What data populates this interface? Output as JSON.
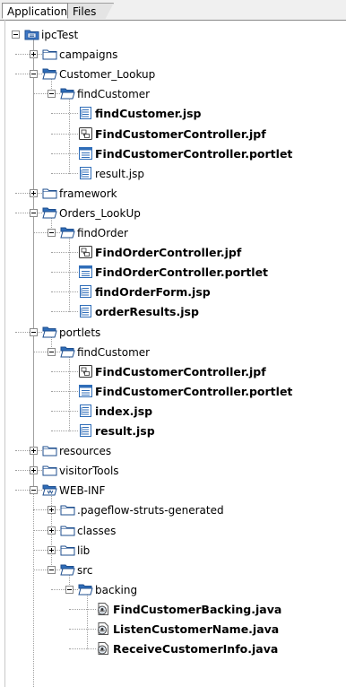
{
  "tabs": [
    {
      "label": "Application",
      "active": true
    },
    {
      "label": "Files",
      "active": false
    }
  ],
  "tree": [
    {
      "label": "ipcTest",
      "icon": "project-icon",
      "depth": 0,
      "expander": "minus",
      "bold": false
    },
    {
      "label": "campaigns",
      "icon": "folder-closed-icon",
      "depth": 1,
      "expander": "plus",
      "bold": false
    },
    {
      "label": "Customer_Lookup",
      "icon": "folder-open-icon",
      "depth": 1,
      "expander": "minus",
      "bold": false
    },
    {
      "label": "findCustomer",
      "icon": "folder-open-icon",
      "depth": 2,
      "expander": "minus",
      "bold": false
    },
    {
      "label": "findCustomer.jsp",
      "icon": "jsp-file-icon",
      "depth": 3,
      "expander": null,
      "bold": true
    },
    {
      "label": "FindCustomerController.jpf",
      "icon": "jpf-file-icon",
      "depth": 3,
      "expander": null,
      "bold": true
    },
    {
      "label": "FindCustomerController.portlet",
      "icon": "portlet-file-icon",
      "depth": 3,
      "expander": null,
      "bold": true
    },
    {
      "label": "result.jsp",
      "icon": "jsp-file-icon",
      "depth": 3,
      "expander": null,
      "bold": false
    },
    {
      "label": "framework",
      "icon": "folder-closed-icon",
      "depth": 1,
      "expander": "plus",
      "bold": false
    },
    {
      "label": "Orders_LookUp",
      "icon": "folder-open-icon",
      "depth": 1,
      "expander": "minus",
      "bold": false
    },
    {
      "label": "findOrder",
      "icon": "folder-open-icon",
      "depth": 2,
      "expander": "minus",
      "bold": false
    },
    {
      "label": "FindOrderController.jpf",
      "icon": "jpf-file-icon",
      "depth": 3,
      "expander": null,
      "bold": true
    },
    {
      "label": "FindOrderController.portlet",
      "icon": "portlet-file-icon",
      "depth": 3,
      "expander": null,
      "bold": true
    },
    {
      "label": "findOrderForm.jsp",
      "icon": "jsp-file-icon",
      "depth": 3,
      "expander": null,
      "bold": true
    },
    {
      "label": "orderResults.jsp",
      "icon": "jsp-file-icon",
      "depth": 3,
      "expander": null,
      "bold": true
    },
    {
      "label": "portlets",
      "icon": "folder-open-icon",
      "depth": 1,
      "expander": "minus",
      "bold": false
    },
    {
      "label": "findCustomer",
      "icon": "folder-open-icon",
      "depth": 2,
      "expander": "minus",
      "bold": false
    },
    {
      "label": "FindCustomerController.jpf",
      "icon": "jpf-file-icon",
      "depth": 3,
      "expander": null,
      "bold": true
    },
    {
      "label": "FindCustomerController.portlet",
      "icon": "portlet-file-icon",
      "depth": 3,
      "expander": null,
      "bold": true
    },
    {
      "label": "index.jsp",
      "icon": "jsp-file-icon",
      "depth": 3,
      "expander": null,
      "bold": true
    },
    {
      "label": "result.jsp",
      "icon": "jsp-file-icon",
      "depth": 3,
      "expander": null,
      "bold": true
    },
    {
      "label": "resources",
      "icon": "folder-closed-icon",
      "depth": 1,
      "expander": "plus",
      "bold": false
    },
    {
      "label": "visitorTools",
      "icon": "folder-closed-icon",
      "depth": 1,
      "expander": "plus",
      "bold": false
    },
    {
      "label": "WEB-INF",
      "icon": "webinf-folder-icon",
      "depth": 1,
      "expander": "minus",
      "bold": false
    },
    {
      "label": ".pageflow-struts-generated",
      "icon": "folder-closed-icon",
      "depth": 2,
      "expander": "plus",
      "bold": false
    },
    {
      "label": "classes",
      "icon": "folder-closed-icon",
      "depth": 2,
      "expander": "plus",
      "bold": false
    },
    {
      "label": "lib",
      "icon": "folder-closed-icon",
      "depth": 2,
      "expander": "plus",
      "bold": false
    },
    {
      "label": "src",
      "icon": "folder-open-icon",
      "depth": 2,
      "expander": "minus",
      "bold": false
    },
    {
      "label": "backing",
      "icon": "folder-open-icon",
      "depth": 3,
      "expander": "minus",
      "bold": false
    },
    {
      "label": "FindCustomerBacking.java",
      "icon": "java-file-icon",
      "depth": 4,
      "expander": null,
      "bold": true
    },
    {
      "label": "ListenCustomerName.java",
      "icon": "java-file-icon",
      "depth": 4,
      "expander": null,
      "bold": true
    },
    {
      "label": "ReceiveCustomerInfo.java",
      "icon": "java-file-icon",
      "depth": 4,
      "expander": null,
      "bold": true
    }
  ]
}
